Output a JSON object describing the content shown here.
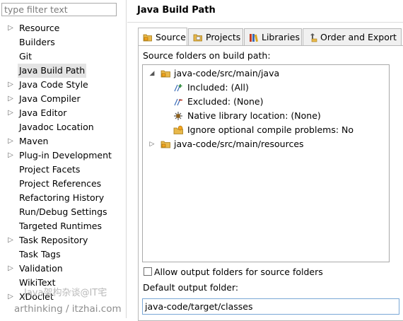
{
  "filter": {
    "placeholder": "type filter text",
    "value": ""
  },
  "nav": {
    "items": [
      {
        "label": "Resource",
        "expandable": true
      },
      {
        "label": "Builders",
        "expandable": false
      },
      {
        "label": "Git",
        "expandable": false
      },
      {
        "label": "Java Build Path",
        "expandable": false,
        "selected": true
      },
      {
        "label": "Java Code Style",
        "expandable": true
      },
      {
        "label": "Java Compiler",
        "expandable": true
      },
      {
        "label": "Java Editor",
        "expandable": true
      },
      {
        "label": "Javadoc Location",
        "expandable": false
      },
      {
        "label": "Maven",
        "expandable": true
      },
      {
        "label": "Plug-in Development",
        "expandable": true
      },
      {
        "label": "Project Facets",
        "expandable": false
      },
      {
        "label": "Project References",
        "expandable": false
      },
      {
        "label": "Refactoring History",
        "expandable": false
      },
      {
        "label": "Run/Debug Settings",
        "expandable": false
      },
      {
        "label": "Targeted Runtimes",
        "expandable": false
      },
      {
        "label": "Task Repository",
        "expandable": true
      },
      {
        "label": "Task Tags",
        "expandable": false
      },
      {
        "label": "Validation",
        "expandable": true
      },
      {
        "label": "WikiText",
        "expandable": false
      },
      {
        "label": "XDoclet",
        "expandable": true
      }
    ]
  },
  "page": {
    "title": "Java Build Path"
  },
  "tabs": [
    {
      "label": "Source",
      "icon": "source-folder-icon",
      "active": true
    },
    {
      "label": "Projects",
      "icon": "projects-icon",
      "active": false
    },
    {
      "label": "Libraries",
      "icon": "libraries-icon",
      "active": false
    },
    {
      "label": "Order and Export",
      "icon": "order-export-icon",
      "active": false
    }
  ],
  "source": {
    "label": "Source folders on build path:",
    "tree": {
      "folder1": "java-code/src/main/java",
      "included": "Included: (All)",
      "excluded": "Excluded: (None)",
      "native": "Native library location: (None)",
      "ignore": "Ignore optional compile problems: No",
      "folder2": "java-code/src/main/resources"
    },
    "allow_output_label": "Allow output folders for source folders",
    "allow_output_checked": false,
    "default_output_label": "Default output folder:",
    "default_output_value": "java-code/target/classes"
  },
  "watermark": {
    "line1": "Java架构杂谈@IT宅",
    "line2": "arthinking / itzhai.com"
  },
  "colors": {
    "folder": "#e8b84a",
    "selection": "#e3e3e3",
    "field_border": "#7aa7d6"
  }
}
